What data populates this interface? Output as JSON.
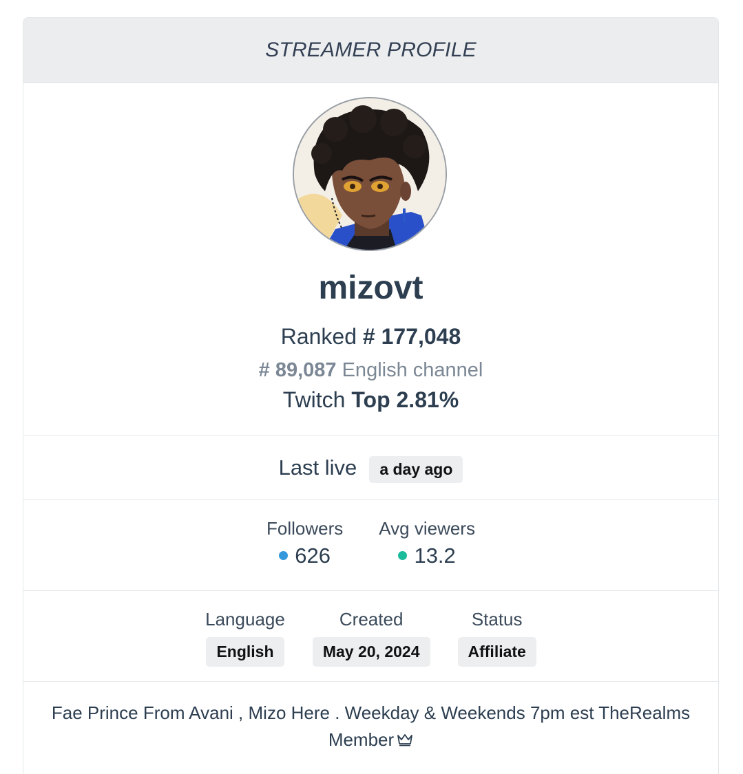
{
  "header": {
    "title": "STREAMER PROFILE"
  },
  "profile": {
    "avatar_alt": "mizovt avatar",
    "name": "mizovt",
    "rank_prefix": "Ranked",
    "rank_value": "# 177,048",
    "lang_rank_value": "# 89,087",
    "lang_rank_suffix": "English channel",
    "twitch_prefix": "Twitch",
    "twitch_value": "Top 2.81%"
  },
  "last_live": {
    "label": "Last live",
    "value": "a day ago"
  },
  "stats": {
    "followers_label": "Followers",
    "followers_value": "626",
    "followers_color": "#3498db",
    "avg_viewers_label": "Avg viewers",
    "avg_viewers_value": "13.2",
    "avg_viewers_color": "#1abc9c"
  },
  "meta": {
    "language_label": "Language",
    "language_value": "English",
    "created_label": "Created",
    "created_value": "May 20, 2024",
    "status_label": "Status",
    "status_value": "Affiliate"
  },
  "bio": {
    "text": "Fae Prince From Avani , Mizo Here . Weekday & Weekends 7pm est TheRealms Member",
    "icon": "crown-icon"
  }
}
